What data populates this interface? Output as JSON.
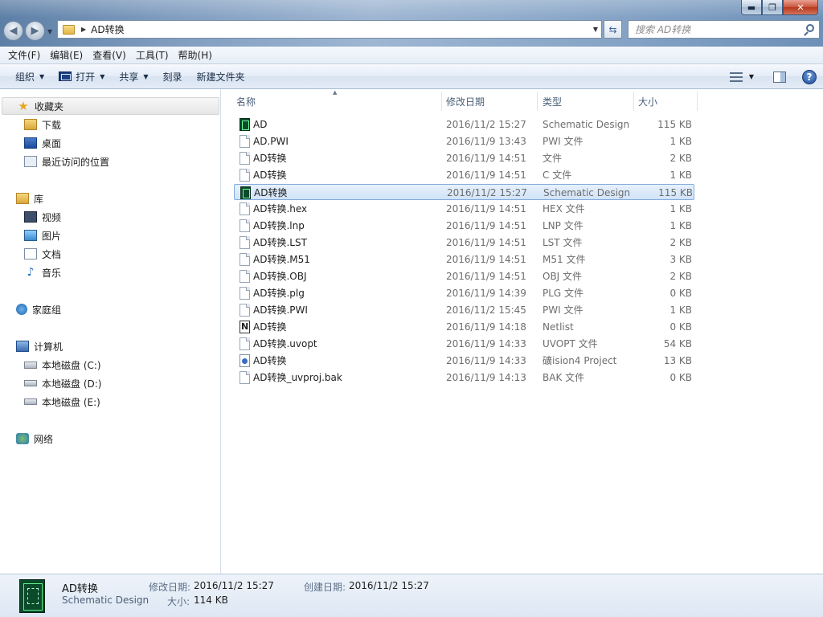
{
  "titlebar": {
    "window_buttons": {
      "minimize": "▬",
      "maximize": "❐",
      "close": "✕"
    },
    "breadcrumb": "AD转换",
    "search_placeholder": "搜索 AD转换"
  },
  "menubar": {
    "items": [
      "文件(F)",
      "编辑(E)",
      "查看(V)",
      "工具(T)",
      "帮助(H)"
    ]
  },
  "commandbar": {
    "organize": "组织",
    "open": "打开",
    "share": "共享",
    "burn": "刻录",
    "new_folder": "新建文件夹"
  },
  "navpane": {
    "favorites": {
      "label": "收藏夹",
      "items": [
        "下载",
        "桌面",
        "最近访问的位置"
      ]
    },
    "libraries": {
      "label": "库",
      "items": [
        "视频",
        "图片",
        "文档",
        "音乐"
      ]
    },
    "homegroup": "家庭组",
    "computer": {
      "label": "计算机",
      "items": [
        "本地磁盘 (C:)",
        "本地磁盘 (D:)",
        "本地磁盘 (E:)"
      ]
    },
    "network": "网络"
  },
  "columns": {
    "name": "名称",
    "date": "修改日期",
    "type": "类型",
    "size": "大小"
  },
  "files": [
    {
      "name": "AD",
      "date": "2016/11/2 15:27",
      "type": "Schematic Design",
      "size": "115 KB",
      "icon": "schematic-icon"
    },
    {
      "name": "AD.PWI",
      "date": "2016/11/9 13:43",
      "type": "PWI 文件",
      "size": "1 KB",
      "icon": "file-icon"
    },
    {
      "name": "AD转换",
      "date": "2016/11/9 14:51",
      "type": "文件",
      "size": "2 KB",
      "icon": "file-icon"
    },
    {
      "name": "AD转换",
      "date": "2016/11/9 14:51",
      "type": "C 文件",
      "size": "1 KB",
      "icon": "file-icon"
    },
    {
      "name": "AD转换",
      "date": "2016/11/2 15:27",
      "type": "Schematic Design",
      "size": "115 KB",
      "icon": "schematic-icon",
      "selected": true
    },
    {
      "name": "AD转换.hex",
      "date": "2016/11/9 14:51",
      "type": "HEX 文件",
      "size": "1 KB",
      "icon": "file-icon"
    },
    {
      "name": "AD转换.lnp",
      "date": "2016/11/9 14:51",
      "type": "LNP 文件",
      "size": "1 KB",
      "icon": "file-icon"
    },
    {
      "name": "AD转换.LST",
      "date": "2016/11/9 14:51",
      "type": "LST 文件",
      "size": "2 KB",
      "icon": "file-icon"
    },
    {
      "name": "AD转换.M51",
      "date": "2016/11/9 14:51",
      "type": "M51 文件",
      "size": "3 KB",
      "icon": "file-icon"
    },
    {
      "name": "AD转换.OBJ",
      "date": "2016/11/9 14:51",
      "type": "OBJ 文件",
      "size": "2 KB",
      "icon": "file-icon"
    },
    {
      "name": "AD转换.plg",
      "date": "2016/11/9 14:39",
      "type": "PLG 文件",
      "size": "0 KB",
      "icon": "file-icon"
    },
    {
      "name": "AD转换.PWI",
      "date": "2016/11/2 15:45",
      "type": "PWI 文件",
      "size": "1 KB",
      "icon": "file-icon"
    },
    {
      "name": "AD转换",
      "date": "2016/11/9 14:18",
      "type": "Netlist",
      "size": "0 KB",
      "icon": "netlist-icon"
    },
    {
      "name": "AD转换.uvopt",
      "date": "2016/11/9 14:33",
      "type": "UVOPT 文件",
      "size": "54 KB",
      "icon": "file-icon"
    },
    {
      "name": "AD转换",
      "date": "2016/11/9 14:33",
      "type": "礦ision4 Project",
      "size": "13 KB",
      "icon": "uvproj-icon"
    },
    {
      "name": "AD转换_uvproj.bak",
      "date": "2016/11/9 14:13",
      "type": "BAK 文件",
      "size": "0 KB",
      "icon": "file-icon"
    }
  ],
  "details": {
    "name": "AD转换",
    "type": "Schematic Design",
    "modified_label": "修改日期:",
    "modified": "2016/11/2 15:27",
    "created_label": "创建日期:",
    "created": "2016/11/2 15:27",
    "size_label": "大小:",
    "size": "114 KB"
  }
}
